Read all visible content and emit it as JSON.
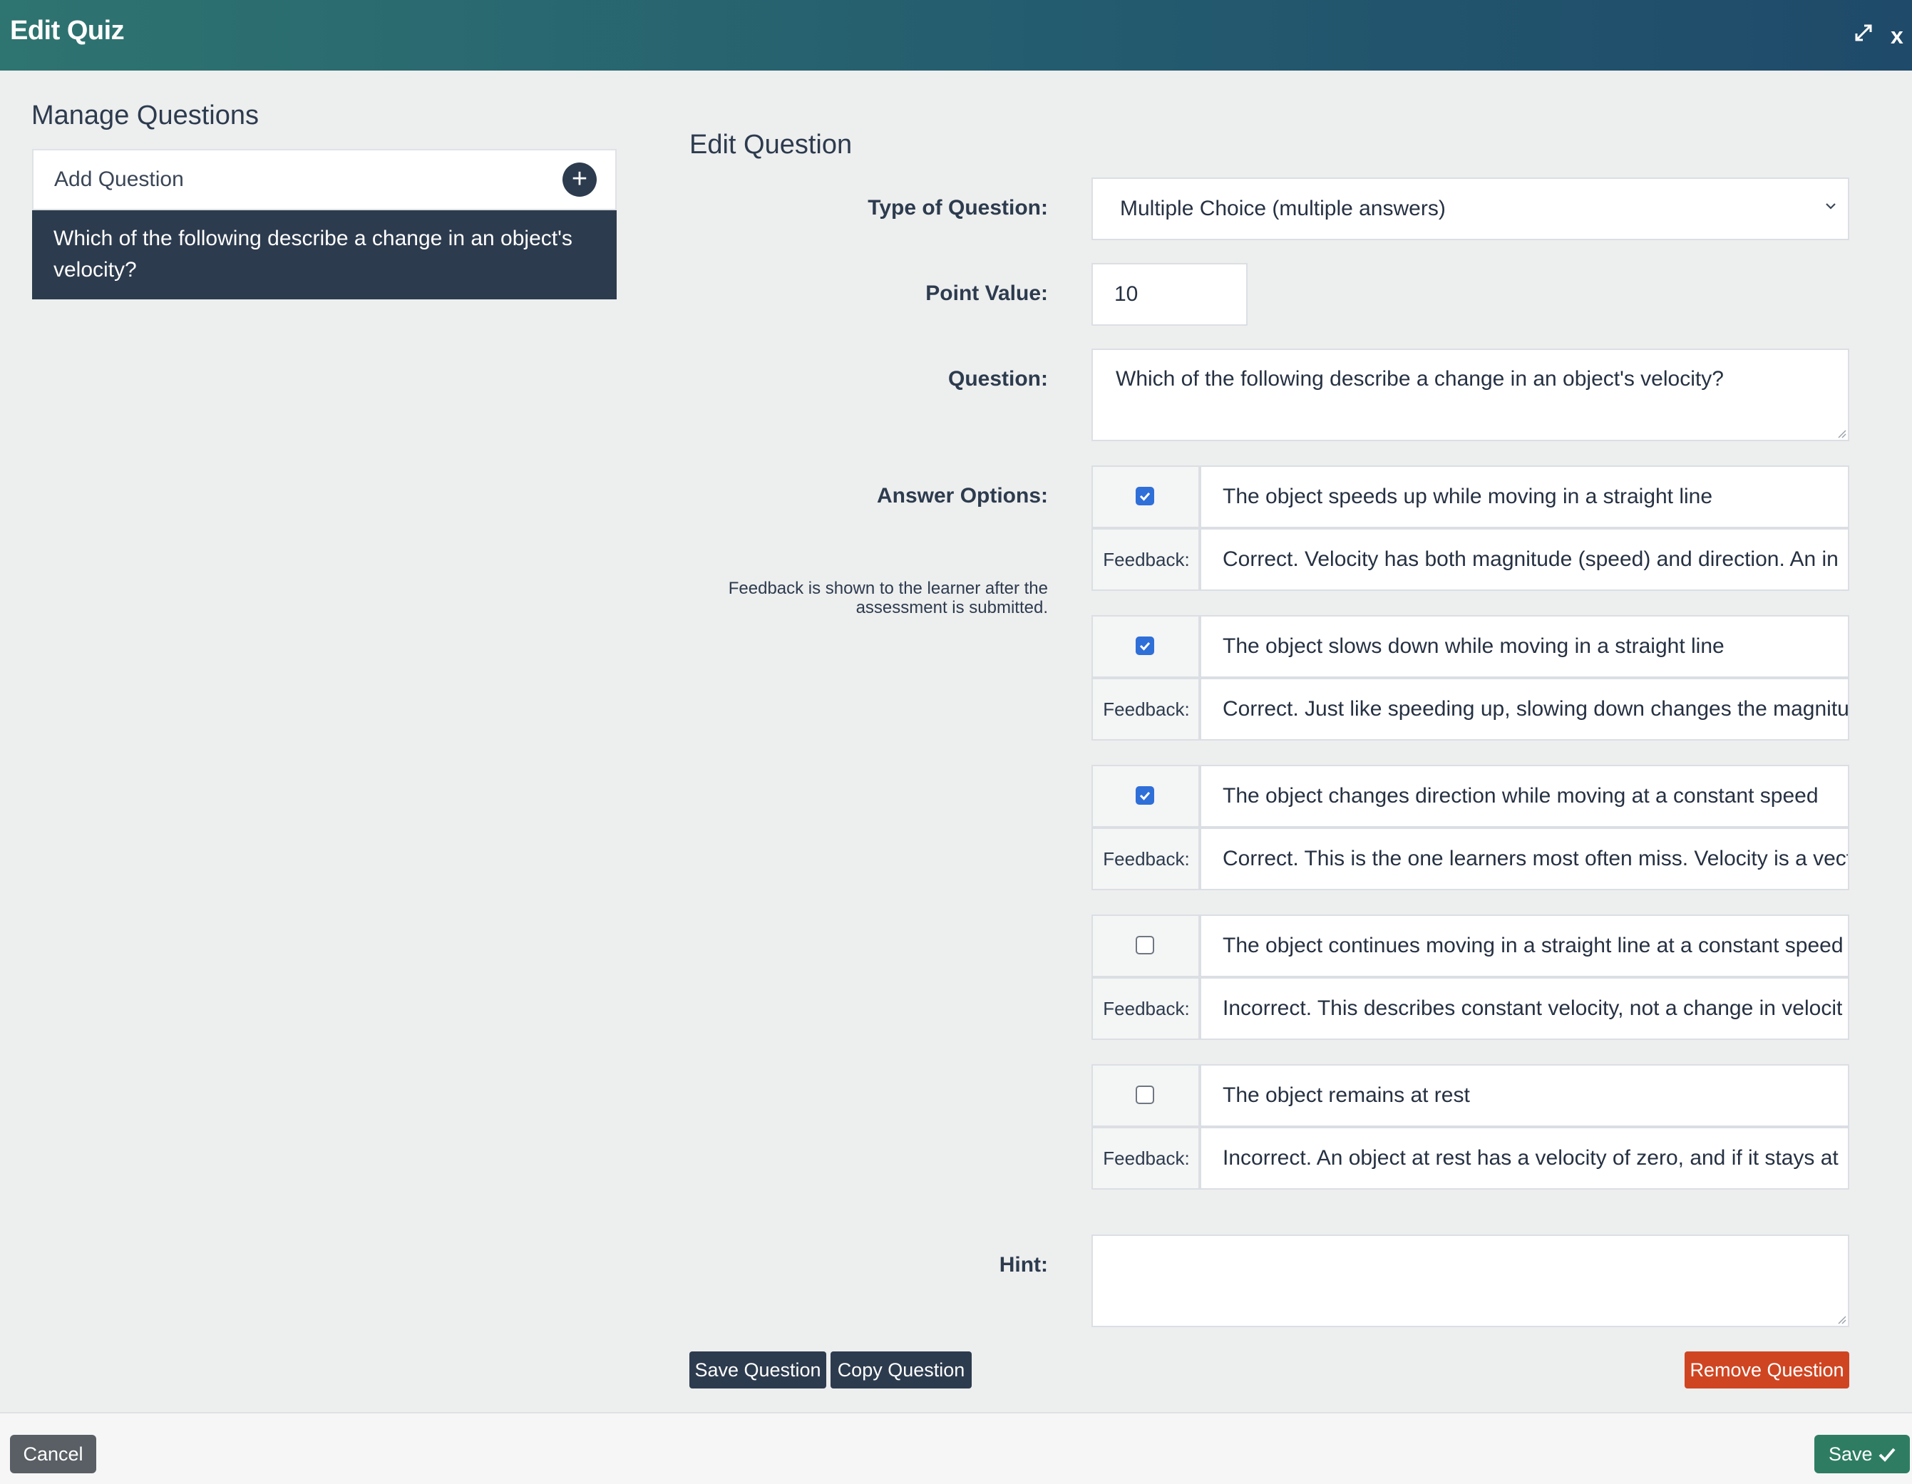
{
  "modal": {
    "title": "Edit Quiz"
  },
  "manage": {
    "title": "Manage Questions",
    "add_label": "Add Question",
    "questions": [
      "Which of the following describe a change in an object's velocity?"
    ]
  },
  "edit": {
    "title": "Edit Question",
    "type_label": "Type of Question:",
    "type_value": "Multiple Choice (multiple answers)",
    "points_label": "Point Value:",
    "points_value": "10",
    "question_label": "Question:",
    "question_value": "Which of the following describe a change in an object's velocity?",
    "answers_label": "Answer Options:",
    "answers_help": "Feedback is shown to the learner after the assessment is submitted.",
    "feedback_label": "Feedback:",
    "hint_label": "Hint:",
    "hint_value": ""
  },
  "options": [
    {
      "checked": true,
      "text": "The object speeds up while moving in a straight line",
      "feedback": "Correct. Velocity has both magnitude (speed) and direction. An in"
    },
    {
      "checked": true,
      "text": " The object slows down while moving in a straight line",
      "feedback": "Correct. Just like speeding up, slowing down changes the magnitu"
    },
    {
      "checked": true,
      "text": "The object changes direction while moving at a constant speed",
      "feedback": "Correct. This is the one learners most often miss. Velocity is a vect"
    },
    {
      "checked": false,
      "text": "The object continues moving in a straight line at a constant speed",
      "feedback": "Incorrect. This describes constant velocity, not a change in velocit"
    },
    {
      "checked": false,
      "text": "The object remains at rest",
      "feedback": "Incorrect. An object at rest has a velocity of zero, and if it stays at"
    }
  ],
  "actions": {
    "save_question": "Save Question",
    "copy_question": "Copy Question",
    "remove_question": "Remove Question"
  },
  "footer": {
    "cancel": "Cancel",
    "save": "Save"
  },
  "icons": {
    "expand": "expand-icon",
    "close": "x",
    "add": "+",
    "check": "checkmark-icon"
  },
  "colors": {
    "header": "#2e7470",
    "dark": "#2d3b4e",
    "danger": "#cf4522",
    "save": "#2e7d63",
    "checkbox": "#2f6fd8"
  }
}
